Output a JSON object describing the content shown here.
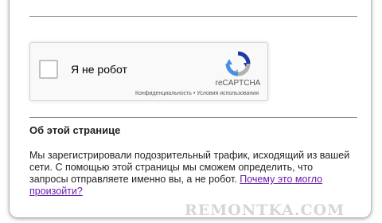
{
  "recaptcha": {
    "label": "Я не робот",
    "brand": "reCAPTCHA",
    "privacy_link": "Конфиденциальность",
    "separator": " • ",
    "terms_link": "Условия использования",
    "logo_icon": "recaptcha-logo-icon",
    "colors": {
      "blue": "#1c3aa9",
      "light_blue": "#4a90e2",
      "gray": "#b1b1b1"
    }
  },
  "about": {
    "heading": "Об этой странице",
    "text": "Мы зарегистрировали подозрительный трафик, исходящий из вашей сети. С помощью этой страницы мы сможем определить, что запросы отправляете именно вы, а не робот. ",
    "link": "Почему это могло произойти?",
    "link_color": "#681da8"
  },
  "watermark": "REMONTKA.COM"
}
